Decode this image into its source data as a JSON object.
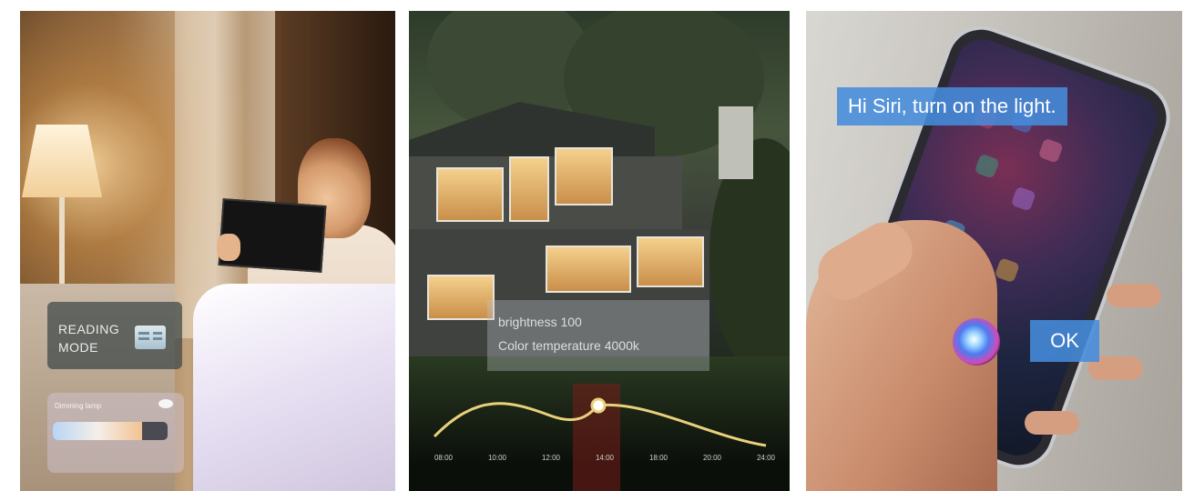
{
  "panels": {
    "reading": {
      "mode_label": "READING\nMODE",
      "dimming_label": "Dimming lamp",
      "dimming_level_percent": 78
    },
    "house": {
      "brightness_line": "brightness   100",
      "color_temp_line": "Color temperature  4000k",
      "timeline": {
        "ticks": [
          "08:00",
          "10:00",
          "12:00",
          "14:00",
          "18:00",
          "20:00",
          "24:00"
        ],
        "selected": "14:00"
      }
    },
    "siri": {
      "command": "Hi Siri, turn on the light.",
      "response": "OK"
    }
  },
  "colors": {
    "bubble": "#4a8cdc",
    "curve": "#e9d07a",
    "band": "#7a1e19"
  }
}
